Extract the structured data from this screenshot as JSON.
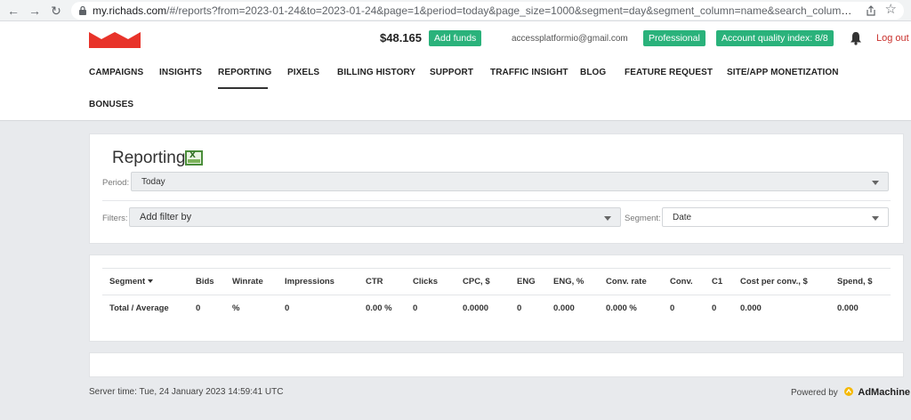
{
  "browser": {
    "url_host": "my.richads.com",
    "url_rest": "/#/reports?from=2023-01-24&to=2023-01-24&page=1&period=today&page_size=1000&segment=day&segment_column=name&search_columns=accepted_clicks&search_..."
  },
  "header": {
    "balance": "$48.165",
    "add_funds": "Add funds",
    "email": "accessplatformio@gmail.com",
    "plan": "Professional",
    "quality": "Account quality index: 8/8",
    "logout": "Log out"
  },
  "menu": [
    "CAMPAIGNS",
    "INSIGHTS",
    "REPORTING",
    "PIXELS",
    "BILLING HISTORY",
    "SUPPORT",
    "TRAFFIC INSIGHT",
    "BLOG",
    "FEATURE REQUEST",
    "SITE/APP MONETIZATION",
    "BONUSES"
  ],
  "reporting": {
    "title": "Reporting",
    "period_label": "Period:",
    "period_value": "Today",
    "filters_label": "Filters:",
    "filter_placeholder": "Add filter by",
    "segment_label": "Segment:",
    "segment_value": "Date"
  },
  "table": {
    "headers": [
      "Segment",
      "Bids",
      "Winrate",
      "Impressions",
      "CTR",
      "Clicks",
      "CPC, $",
      "ENG",
      "ENG, %",
      "Conv. rate",
      "Conv.",
      "C1",
      "Cost per conv., $",
      "Spend, $"
    ],
    "total_row": [
      "Total / Average",
      "0",
      "%",
      "0",
      "0.00 %",
      "0",
      "0.0000",
      "0",
      "0.000",
      "0.000 %",
      "0",
      "0",
      "0.000",
      "0.000"
    ]
  },
  "footer": {
    "server_time": "Server time: Tue, 24 January 2023 14:59:41 UTC",
    "powered_by": "Powered by",
    "brand": "AdMachine"
  },
  "colors": {
    "accent_green": "#2ab27b",
    "logo_red": "#e8332a",
    "logout_red": "#c9302c"
  }
}
